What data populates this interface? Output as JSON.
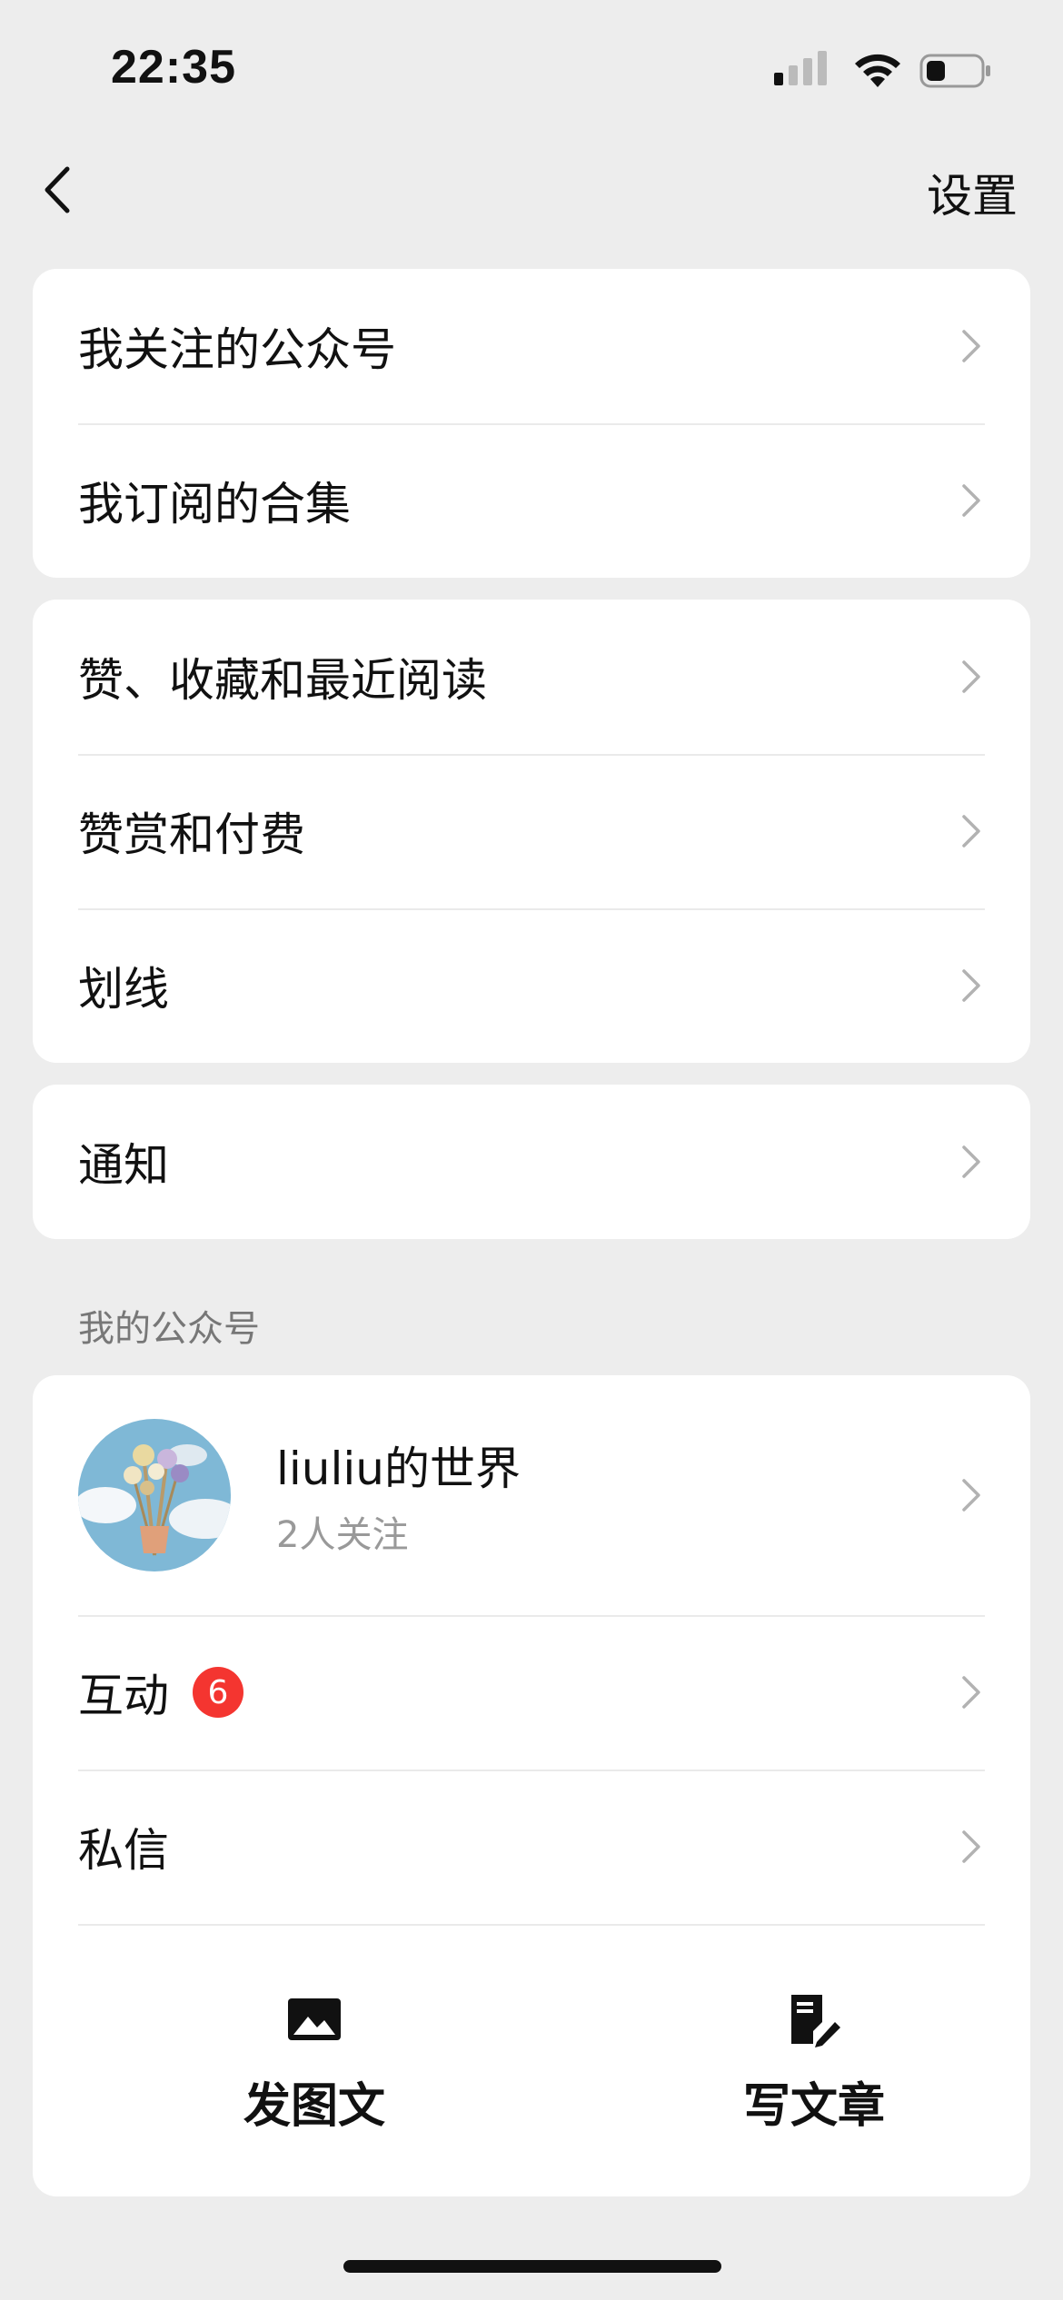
{
  "status": {
    "time": "22:35"
  },
  "nav": {
    "settings_label": "设置"
  },
  "group1": {
    "items": [
      {
        "label": "我关注的公众号"
      },
      {
        "label": "我订阅的合集"
      }
    ]
  },
  "group2": {
    "items": [
      {
        "label": "赞、收藏和最近阅读"
      },
      {
        "label": "赞赏和付费"
      },
      {
        "label": "划线"
      }
    ]
  },
  "group3": {
    "items": [
      {
        "label": "通知"
      }
    ]
  },
  "my_accounts": {
    "section_title": "我的公众号",
    "account": {
      "name": "liuliu的世界",
      "followers": "2人关注"
    },
    "interaction": {
      "label": "互动",
      "badge": "6"
    },
    "messages": {
      "label": "私信"
    },
    "actions": {
      "post_image": "发图文",
      "write_article": "写文章"
    }
  },
  "colors": {
    "background": "#ededed",
    "card": "#ffffff",
    "badge": "#f43530",
    "secondary_text": "#999999"
  },
  "icons": [
    "back-chevron-icon",
    "chevron-right-icon",
    "image-icon",
    "edit-document-icon",
    "signal-icon",
    "wifi-icon",
    "battery-icon"
  ]
}
